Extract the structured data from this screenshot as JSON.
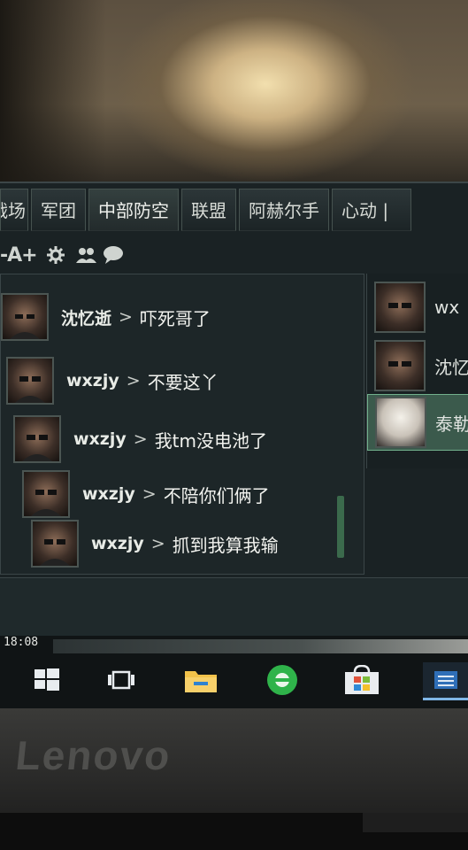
{
  "tabs": [
    {
      "label": "战场"
    },
    {
      "label": "军团"
    },
    {
      "label": "中部防空"
    },
    {
      "label": "联盟"
    },
    {
      "label": "阿赫尔手"
    },
    {
      "label": "心动 |"
    }
  ],
  "toolbar": {
    "font_size_control": "-A+",
    "icons": [
      "gear-icon",
      "group-icon",
      "chat-bubble-icon"
    ]
  },
  "messages": [
    {
      "nick": "沈忆逝",
      "separator": ">",
      "text": "吓死哥了"
    },
    {
      "nick": "wxzjy",
      "separator": ">",
      "text": "不要这丫"
    },
    {
      "nick": "wxzjy",
      "separator": ">",
      "text": "我tm没电池了"
    },
    {
      "nick": "wxzjy",
      "separator": ">",
      "text": "不陪你们俩了"
    },
    {
      "nick": "wxzjy",
      "separator": ">",
      "text": "抓到我算我输"
    }
  ],
  "users": [
    {
      "name": "wx",
      "selected": false
    },
    {
      "name": "沈忆",
      "selected": false
    },
    {
      "name": "泰勒",
      "selected": true
    }
  ],
  "taskbar": {
    "clock": "18:08",
    "apps": [
      "windows-start-icon",
      "task-view-icon",
      "file-explorer-icon",
      "edge-browser-icon",
      "store-icon",
      "active-app-icon"
    ]
  },
  "bezel": {
    "brand": "Lenovo"
  },
  "colors": {
    "screen_bg": "#1a2224",
    "selected_user": "#3b5a4c",
    "taskbar_accent": "#7fb6e6"
  }
}
